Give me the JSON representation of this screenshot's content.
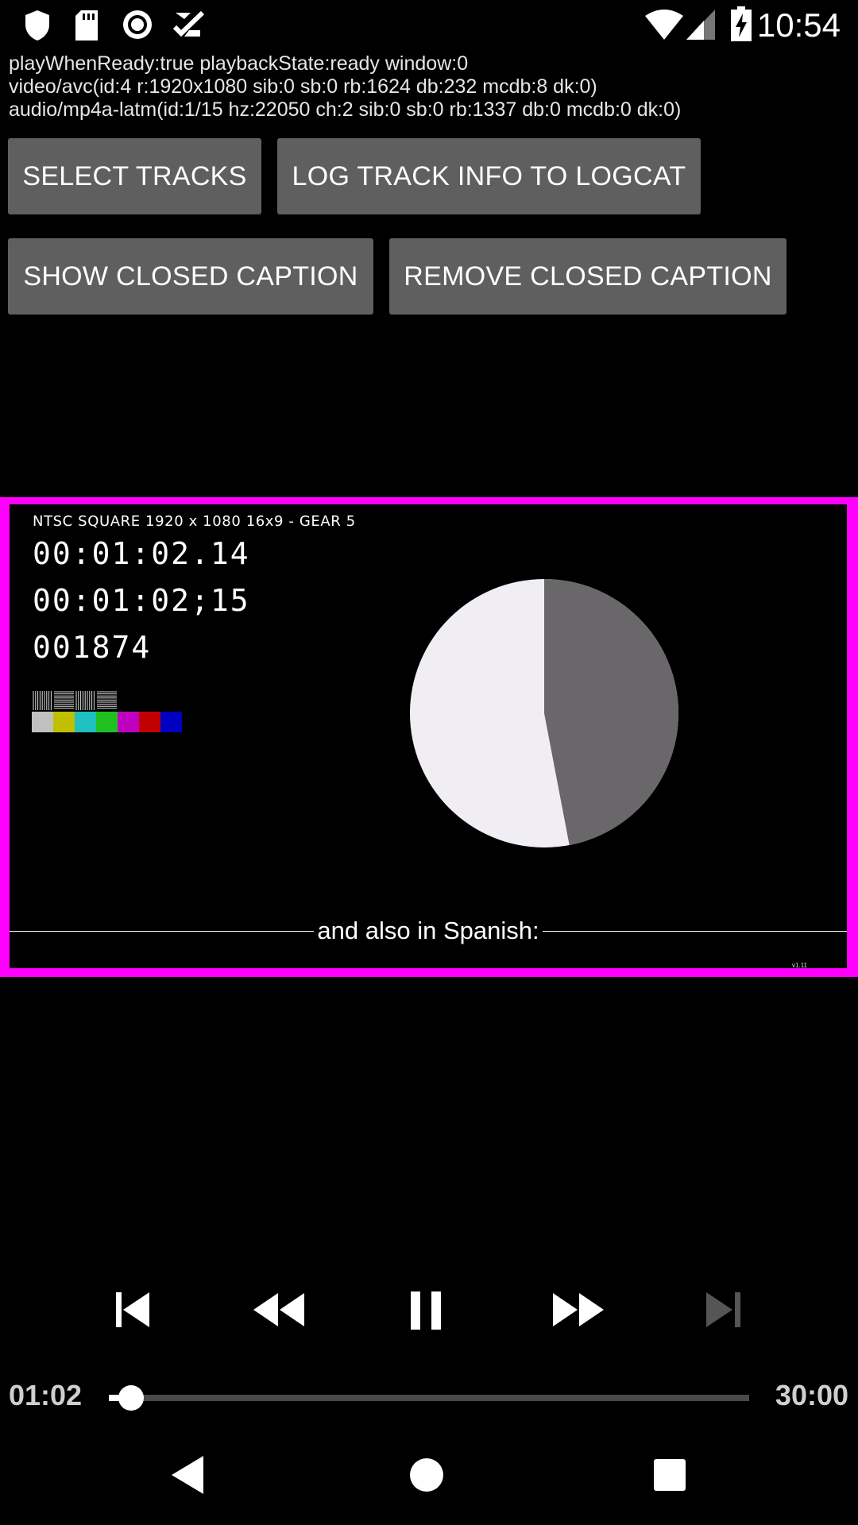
{
  "status_bar": {
    "time": "10:54",
    "left_icons": [
      "shield-icon",
      "sd-card-icon",
      "record-icon",
      "checklist-icon"
    ],
    "right_icons": [
      "wifi-icon",
      "cell-signal-icon",
      "battery-charging-icon"
    ]
  },
  "debug": {
    "line1": "playWhenReady:true playbackState:ready window:0",
    "line2": "video/avc(id:4 r:1920x1080 sib:0 sb:0 rb:1624 db:232 mcdb:8 dk:0)",
    "line3": "audio/mp4a-latm(id:1/15 hz:22050 ch:2 sib:0 sb:0 rb:1337 db:0 mcdb:0 dk:0)"
  },
  "buttons": {
    "select_tracks": "SELECT TRACKS",
    "log_track_info": "LOG TRACK INFO TO LOGCAT",
    "show_cc": "SHOW CLOSED CAPTION",
    "remove_cc": "REMOVE CLOSED CAPTION"
  },
  "video": {
    "header": "NTSC SQUARE  1920 x 1080  16x9  -  GEAR 5",
    "timecode1": "00:01:02.14",
    "timecode2": "00:01:02;15",
    "frame_count": "001874",
    "caption": "and also in Spanish:",
    "version": "v1.11",
    "border_color": "#ff00ff",
    "pie_progress_fraction": 0.47,
    "color_bars": [
      "#c0c0c0",
      "#c0c000",
      "#20c0c0",
      "#20c020",
      "#c000c0",
      "#c00000",
      "#0000c0"
    ]
  },
  "controls": {
    "icons": [
      "skip-previous-icon",
      "rewind-icon",
      "pause-icon",
      "fast-forward-icon",
      "skip-next-icon"
    ],
    "position": "01:02",
    "duration": "30:00",
    "progress_fraction": 0.0344
  },
  "nav": {
    "icons": [
      "back-icon",
      "home-icon",
      "recents-icon"
    ]
  }
}
